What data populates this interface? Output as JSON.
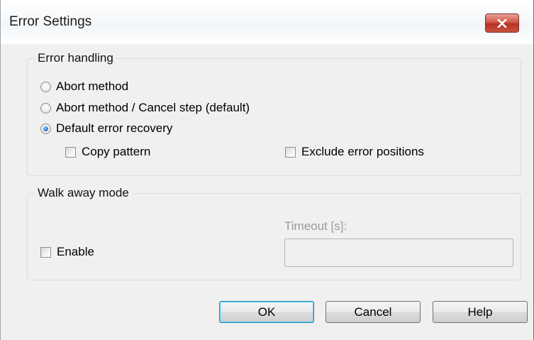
{
  "window": {
    "title": "Error Settings"
  },
  "error_handling": {
    "group_label": "Error handling",
    "options": [
      {
        "label": "Abort method",
        "selected": false
      },
      {
        "label": "Abort method / Cancel step (default)",
        "selected": false
      },
      {
        "label": "Default error recovery",
        "selected": true
      }
    ],
    "copy_pattern": {
      "label": "Copy pattern",
      "checked": false
    },
    "exclude_error_positions": {
      "label": "Exclude error positions",
      "checked": false
    }
  },
  "walk_away": {
    "group_label": "Walk away mode",
    "enable": {
      "label": "Enable",
      "checked": false
    },
    "timeout_label": "Timeout [s]:",
    "timeout_value": ""
  },
  "buttons": {
    "ok": "OK",
    "cancel": "Cancel",
    "help": "Help"
  },
  "icons": {
    "close": "close-icon"
  }
}
